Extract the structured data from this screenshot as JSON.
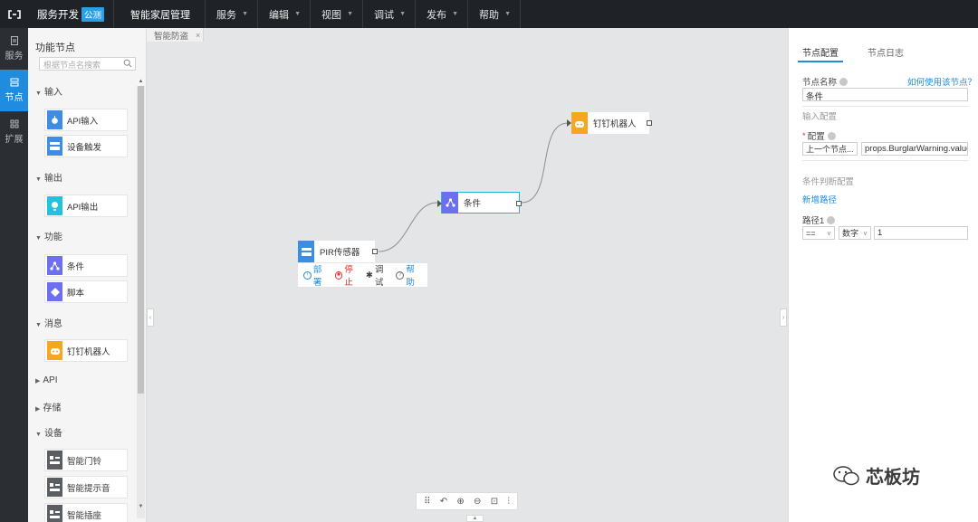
{
  "topbar": {
    "brand": "服务开发",
    "badge": "公测",
    "project": "智能家居管理",
    "menus": [
      "服务",
      "编辑",
      "视图",
      "调试",
      "发布",
      "帮助"
    ]
  },
  "rail": {
    "items": [
      {
        "label": "服务",
        "icon": "document-icon"
      },
      {
        "label": "节点",
        "icon": "nodes-icon"
      },
      {
        "label": "扩展",
        "icon": "grid-icon"
      }
    ]
  },
  "palette": {
    "title": "功能节点",
    "search_placeholder": "根据节点名搜索",
    "groups": {
      "input": "输入",
      "output": "输出",
      "function": "功能",
      "message": "消息",
      "api": "API",
      "storage": "存储",
      "device": "设备"
    },
    "nodes": {
      "api_input": "API输入",
      "device_trigger": "设备触发",
      "api_output": "API输出",
      "condition": "条件",
      "script": "脚本",
      "dingtalk": "钉钉机器人",
      "doorbell": "智能门铃",
      "alarm": "智能提示音",
      "switch": "智能插座"
    }
  },
  "canvas": {
    "tab": "智能防盗",
    "flow_nodes": {
      "pir": "PIR传感器",
      "condition": "条件",
      "dingtalk": "钉钉机器人"
    },
    "node_menu": {
      "deploy": "部署",
      "stop": "停止",
      "debug": "调试",
      "help": "帮助"
    },
    "colors": {
      "blue": "#3d8de6",
      "purple": "#6c6ff0",
      "orange": "#f5a623",
      "cyan": "#24c1de",
      "gray": "#5a5e63",
      "accent": "#1f8ce0",
      "danger": "#e0352b"
    }
  },
  "panel": {
    "tabs": [
      "节点配置",
      "节点日志"
    ],
    "name_label": "节点名称",
    "how_to_link": "如何使用该节点？",
    "name_value": "条件",
    "input_section": "输入配置",
    "config_label": "配置",
    "config_source": "上一个节点...",
    "config_value": "props.BurglarWarning.value",
    "condition_section": "条件判断配置",
    "add_path": "新增路径",
    "path_label": "路径1",
    "operator": "==",
    "value_type": "数字",
    "compare_value": "1"
  },
  "watermark": "芯板坊"
}
